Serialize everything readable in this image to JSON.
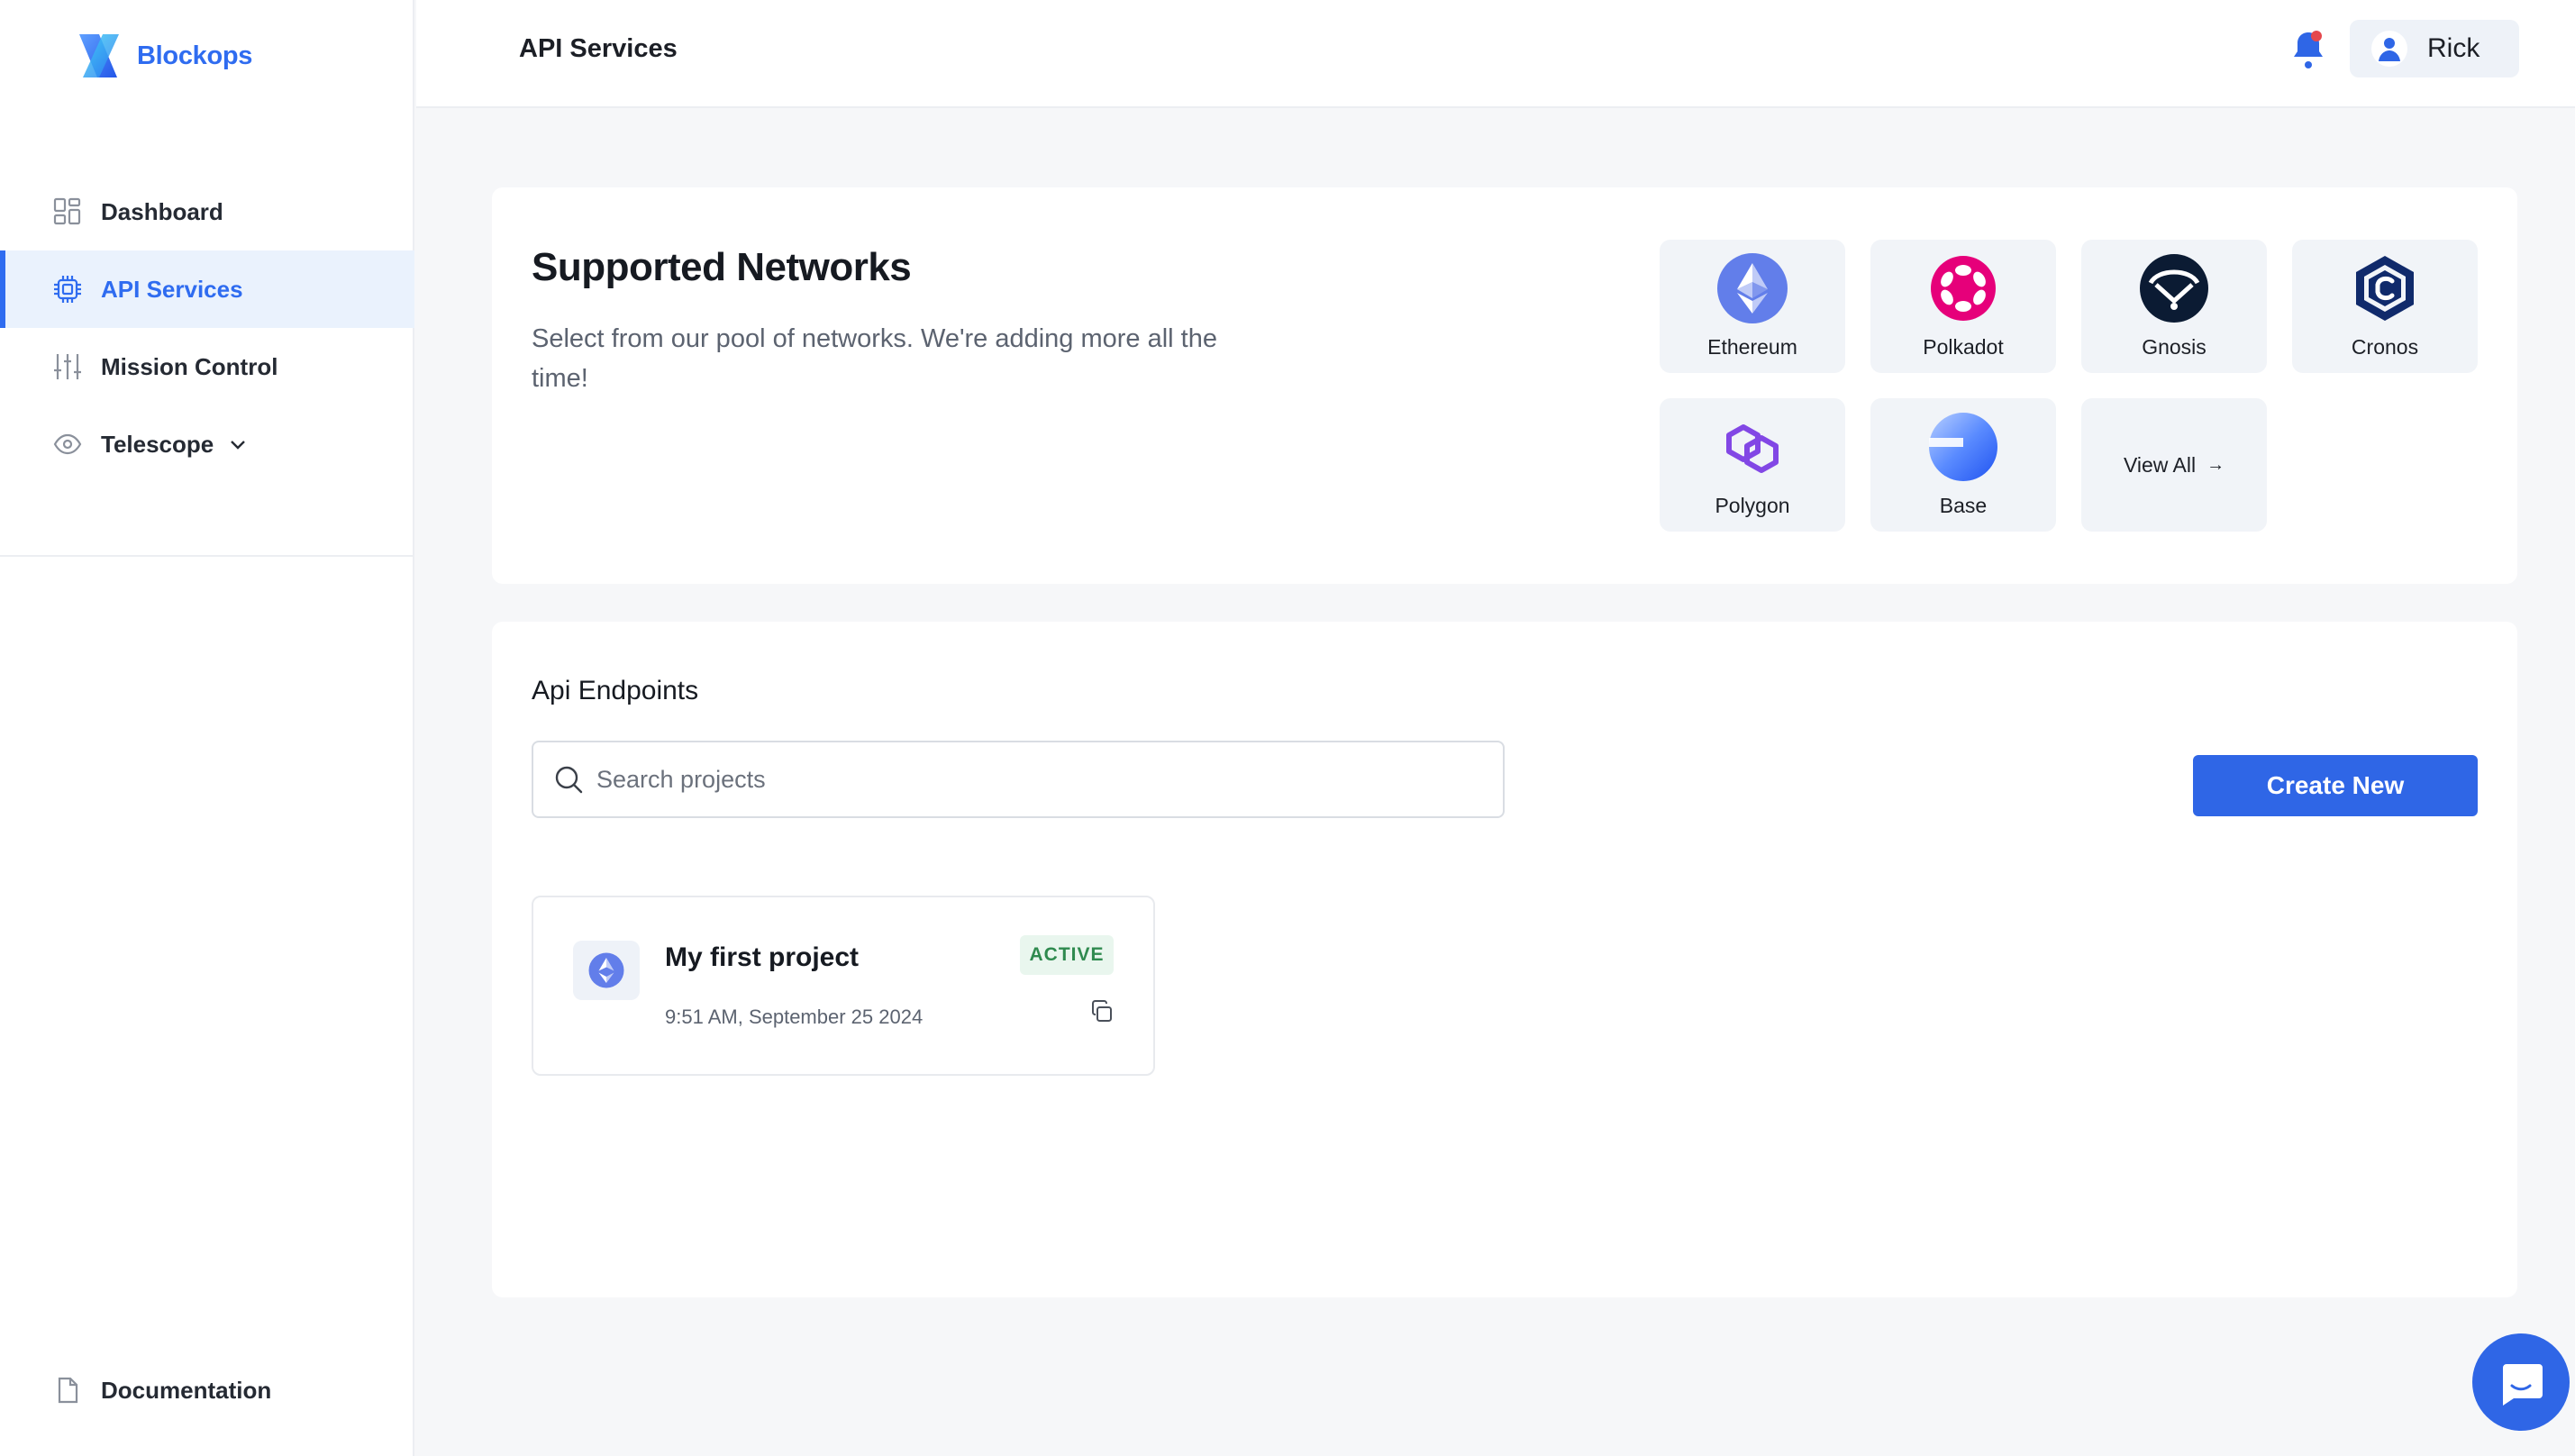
{
  "brand": {
    "name": "Blockops"
  },
  "sidebar": {
    "items": [
      {
        "label": "Dashboard",
        "icon": "dashboard-icon"
      },
      {
        "label": "API Services",
        "icon": "chip-icon",
        "active": true
      },
      {
        "label": "Mission Control",
        "icon": "sliders-icon"
      },
      {
        "label": "Telescope",
        "icon": "eye-icon",
        "expandable": true
      }
    ],
    "footer": {
      "label": "Documentation",
      "icon": "document-icon"
    }
  },
  "header": {
    "title": "API Services",
    "user_name": "Rick",
    "notification_icon": "bell-icon"
  },
  "networks": {
    "title": "Supported Networks",
    "description": "Select from our pool of networks. We're adding more all the time!",
    "tiles": [
      {
        "label": "Ethereum",
        "icon": "ethereum-icon"
      },
      {
        "label": "Polkadot",
        "icon": "polkadot-icon"
      },
      {
        "label": "Gnosis",
        "icon": "gnosis-icon"
      },
      {
        "label": "Cronos",
        "icon": "cronos-icon"
      },
      {
        "label": "Polygon",
        "icon": "polygon-icon"
      },
      {
        "label": "Base",
        "icon": "base-icon"
      }
    ],
    "view_all": "View All",
    "view_all_arrow": "→"
  },
  "endpoints": {
    "title": "Api Endpoints",
    "search_placeholder": "Search projects",
    "create_button": "Create New",
    "projects": [
      {
        "name": "My first project",
        "date": "9:51 AM, September 25 2024",
        "status": "ACTIVE",
        "network_icon": "ethereum-icon"
      }
    ]
  },
  "colors": {
    "accent": "#2f66e6",
    "brand": "#2f6cf0",
    "active_bg": "#eaf2fd",
    "status_green": "#2f8a4f",
    "status_green_bg": "#e9f6ee"
  }
}
